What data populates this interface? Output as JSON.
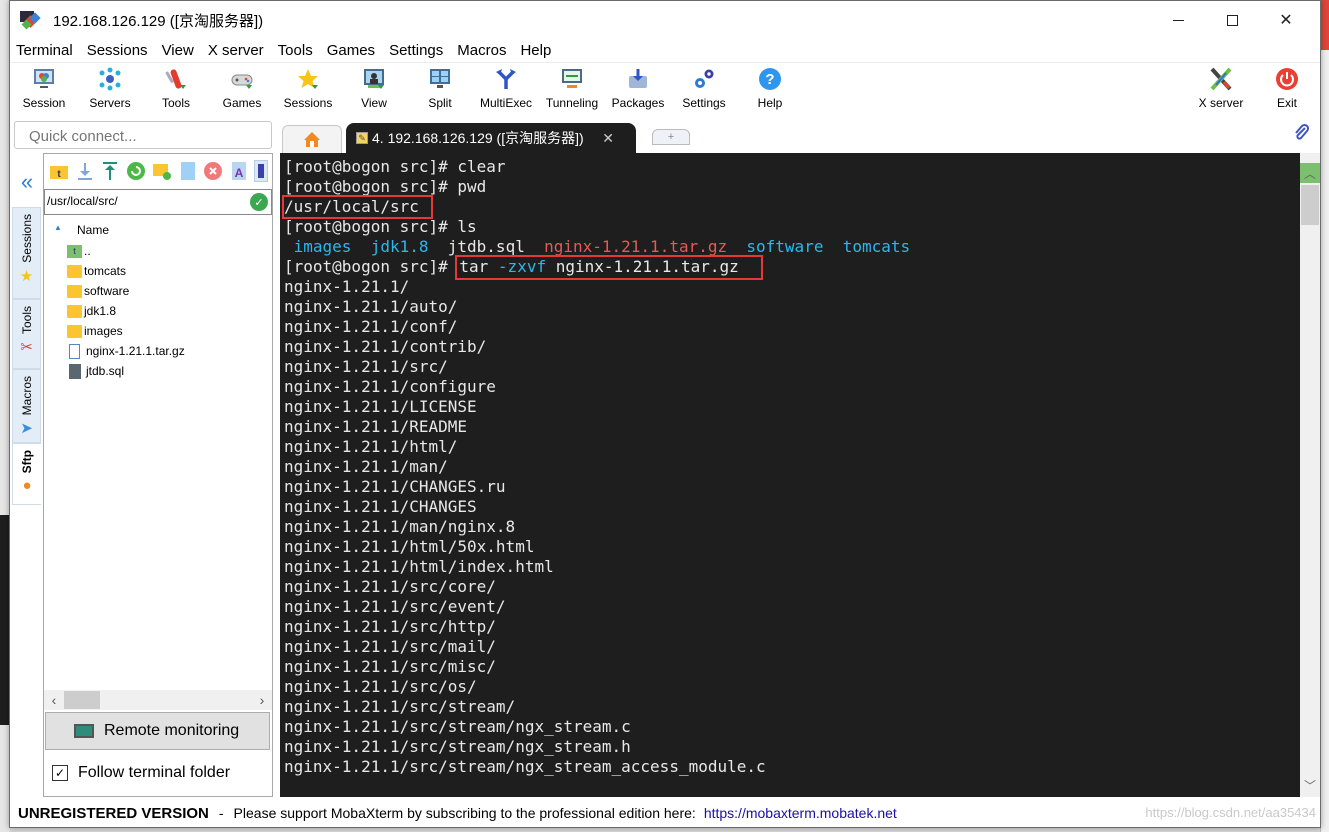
{
  "window": {
    "title": "192.168.126.129 ([京淘服务器])",
    "controls": {
      "minimize": "minimize",
      "maximize": "maximize",
      "close": "✕"
    }
  },
  "menu": [
    "Terminal",
    "Sessions",
    "View",
    "X server",
    "Tools",
    "Games",
    "Settings",
    "Macros",
    "Help"
  ],
  "toolbar": {
    "items": [
      {
        "label": "Session",
        "icon": "session-icon"
      },
      {
        "label": "Servers",
        "icon": "servers-icon"
      },
      {
        "label": "Tools",
        "icon": "tools-icon"
      },
      {
        "label": "Games",
        "icon": "games-icon"
      },
      {
        "label": "Sessions",
        "icon": "sessions-star-icon"
      },
      {
        "label": "View",
        "icon": "view-icon"
      },
      {
        "label": "Split",
        "icon": "split-icon"
      },
      {
        "label": "MultiExec",
        "icon": "multiexec-icon"
      },
      {
        "label": "Tunneling",
        "icon": "tunneling-icon"
      },
      {
        "label": "Packages",
        "icon": "packages-icon"
      },
      {
        "label": "Settings",
        "icon": "settings-icon"
      },
      {
        "label": "Help",
        "icon": "help-icon"
      }
    ],
    "right_items": [
      {
        "label": "X server",
        "icon": "xserver-icon"
      },
      {
        "label": "Exit",
        "icon": "exit-icon"
      }
    ]
  },
  "quick_connect": {
    "placeholder": "Quick connect..."
  },
  "tabs": {
    "home_icon": "home-icon",
    "session_tab": {
      "label": "4.  192.168.126.129  ([京淘服务器])",
      "close": "✕"
    },
    "new_tab": "+"
  },
  "side_tabs": [
    {
      "label": "Sessions",
      "icon": "★"
    },
    {
      "label": "Tools",
      "icon": "✂"
    },
    {
      "label": "Macros",
      "icon": "➤"
    },
    {
      "label": "Sftp",
      "icon": "●"
    }
  ],
  "sftp": {
    "collapse_icon": "«",
    "path": "/usr/local/src/",
    "column_name": "Name",
    "files": [
      {
        "name": "..",
        "type": "parent"
      },
      {
        "name": "tomcats",
        "type": "folder"
      },
      {
        "name": "software",
        "type": "folder"
      },
      {
        "name": "jdk1.8",
        "type": "folder"
      },
      {
        "name": "images",
        "type": "folder"
      },
      {
        "name": "nginx-1.21.1.tar.gz",
        "type": "archive"
      },
      {
        "name": "jtdb.sql",
        "type": "file"
      }
    ],
    "remote_monitoring": "Remote monitoring",
    "follow_terminal_folder": "Follow terminal folder",
    "follow_checked": true
  },
  "terminal": {
    "prompt": "[root@bogon src]# ",
    "cmd_clear": "clear",
    "cmd_pwd": "pwd",
    "pwd_output": "/usr/local/src",
    "cmd_ls": "ls",
    "ls_output": [
      {
        "name": "images",
        "color": "blue"
      },
      {
        "name": "jdk1.8",
        "color": "blue"
      },
      {
        "name": "jtdb.sql",
        "color": "default"
      },
      {
        "name": "nginx-1.21.1.tar.gz",
        "color": "red"
      },
      {
        "name": "software",
        "color": "blue"
      },
      {
        "name": "tomcats",
        "color": "blue"
      }
    ],
    "cmd_tar_prefix": "tar ",
    "cmd_tar_flags": "-zxvf",
    "cmd_tar_arg": " nginx-1.21.1.tar.gz",
    "tar_output": [
      "nginx-1.21.1/",
      "nginx-1.21.1/auto/",
      "nginx-1.21.1/conf/",
      "nginx-1.21.1/contrib/",
      "nginx-1.21.1/src/",
      "nginx-1.21.1/configure",
      "nginx-1.21.1/LICENSE",
      "nginx-1.21.1/README",
      "nginx-1.21.1/html/",
      "nginx-1.21.1/man/",
      "nginx-1.21.1/CHANGES.ru",
      "nginx-1.21.1/CHANGES",
      "nginx-1.21.1/man/nginx.8",
      "nginx-1.21.1/html/50x.html",
      "nginx-1.21.1/html/index.html",
      "nginx-1.21.1/src/core/",
      "nginx-1.21.1/src/event/",
      "nginx-1.21.1/src/http/",
      "nginx-1.21.1/src/mail/",
      "nginx-1.21.1/src/misc/",
      "nginx-1.21.1/src/os/",
      "nginx-1.21.1/src/stream/",
      "nginx-1.21.1/src/stream/ngx_stream.c",
      "nginx-1.21.1/src/stream/ngx_stream.h",
      "nginx-1.21.1/src/stream/ngx_stream_access_module.c"
    ],
    "colors": {
      "background": "#1e1e1e",
      "text": "#e8e8e8",
      "blue": "#2ab7ed",
      "red": "#e95757",
      "highlight_box": "#e53935"
    }
  },
  "statusbar": {
    "unregistered": "UNREGISTERED VERSION",
    "separator": "-",
    "message": "Please support MobaXterm by subscribing to the professional edition here:",
    "link": "https://mobaxterm.mobatek.net",
    "watermark": "https://blog.csdn.net/aa35434"
  }
}
